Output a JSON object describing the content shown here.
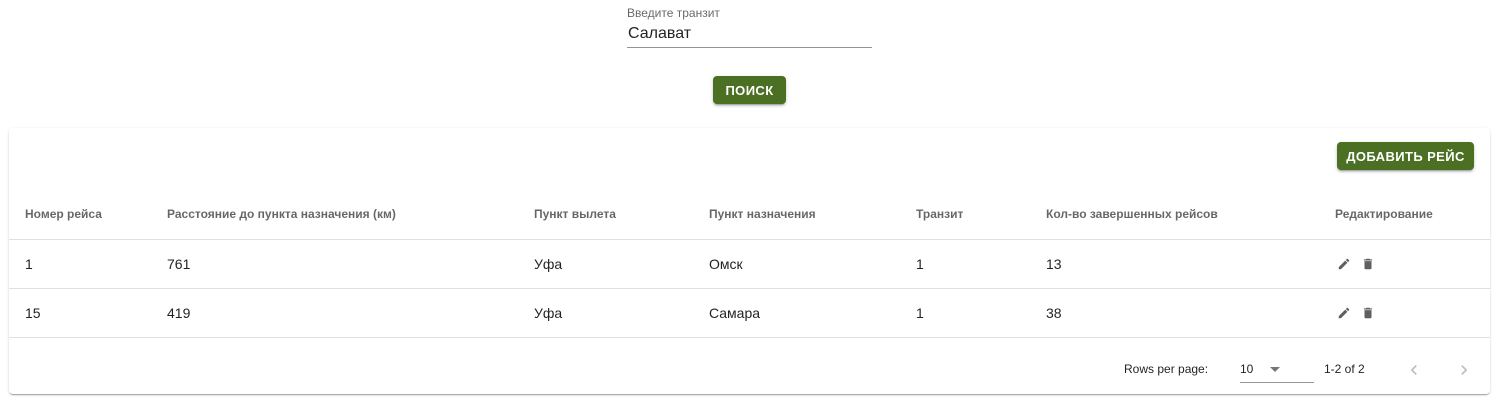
{
  "search": {
    "label": "Введите транзит",
    "value": "Салават",
    "button_label": "Поиск"
  },
  "toolbar": {
    "add_label": "Добавить рейс"
  },
  "table": {
    "headers": [
      "Номер рейса",
      "Расстояние до пункта назначения (км)",
      "Пункт вылета",
      "Пункт назначения",
      "Транзит",
      "Кол-во завершенных рейсов",
      "Редактирование"
    ],
    "rows": [
      [
        "1",
        "761",
        "Уфа",
        "Омск",
        "1",
        "13"
      ],
      [
        "15",
        "419",
        "Уфа",
        "Самара",
        "1",
        "38"
      ]
    ],
    "row_actions": [
      "edit-icon",
      "delete-icon"
    ]
  },
  "pagination": {
    "rows_per_page_label": "Rows per page:",
    "rows_per_page_value": "10",
    "range_text": "1-2 of 2"
  },
  "colors": {
    "primary": "#4b6f23",
    "icon": "#5f5f5f",
    "icon_disabled": "#bdbdbd"
  }
}
